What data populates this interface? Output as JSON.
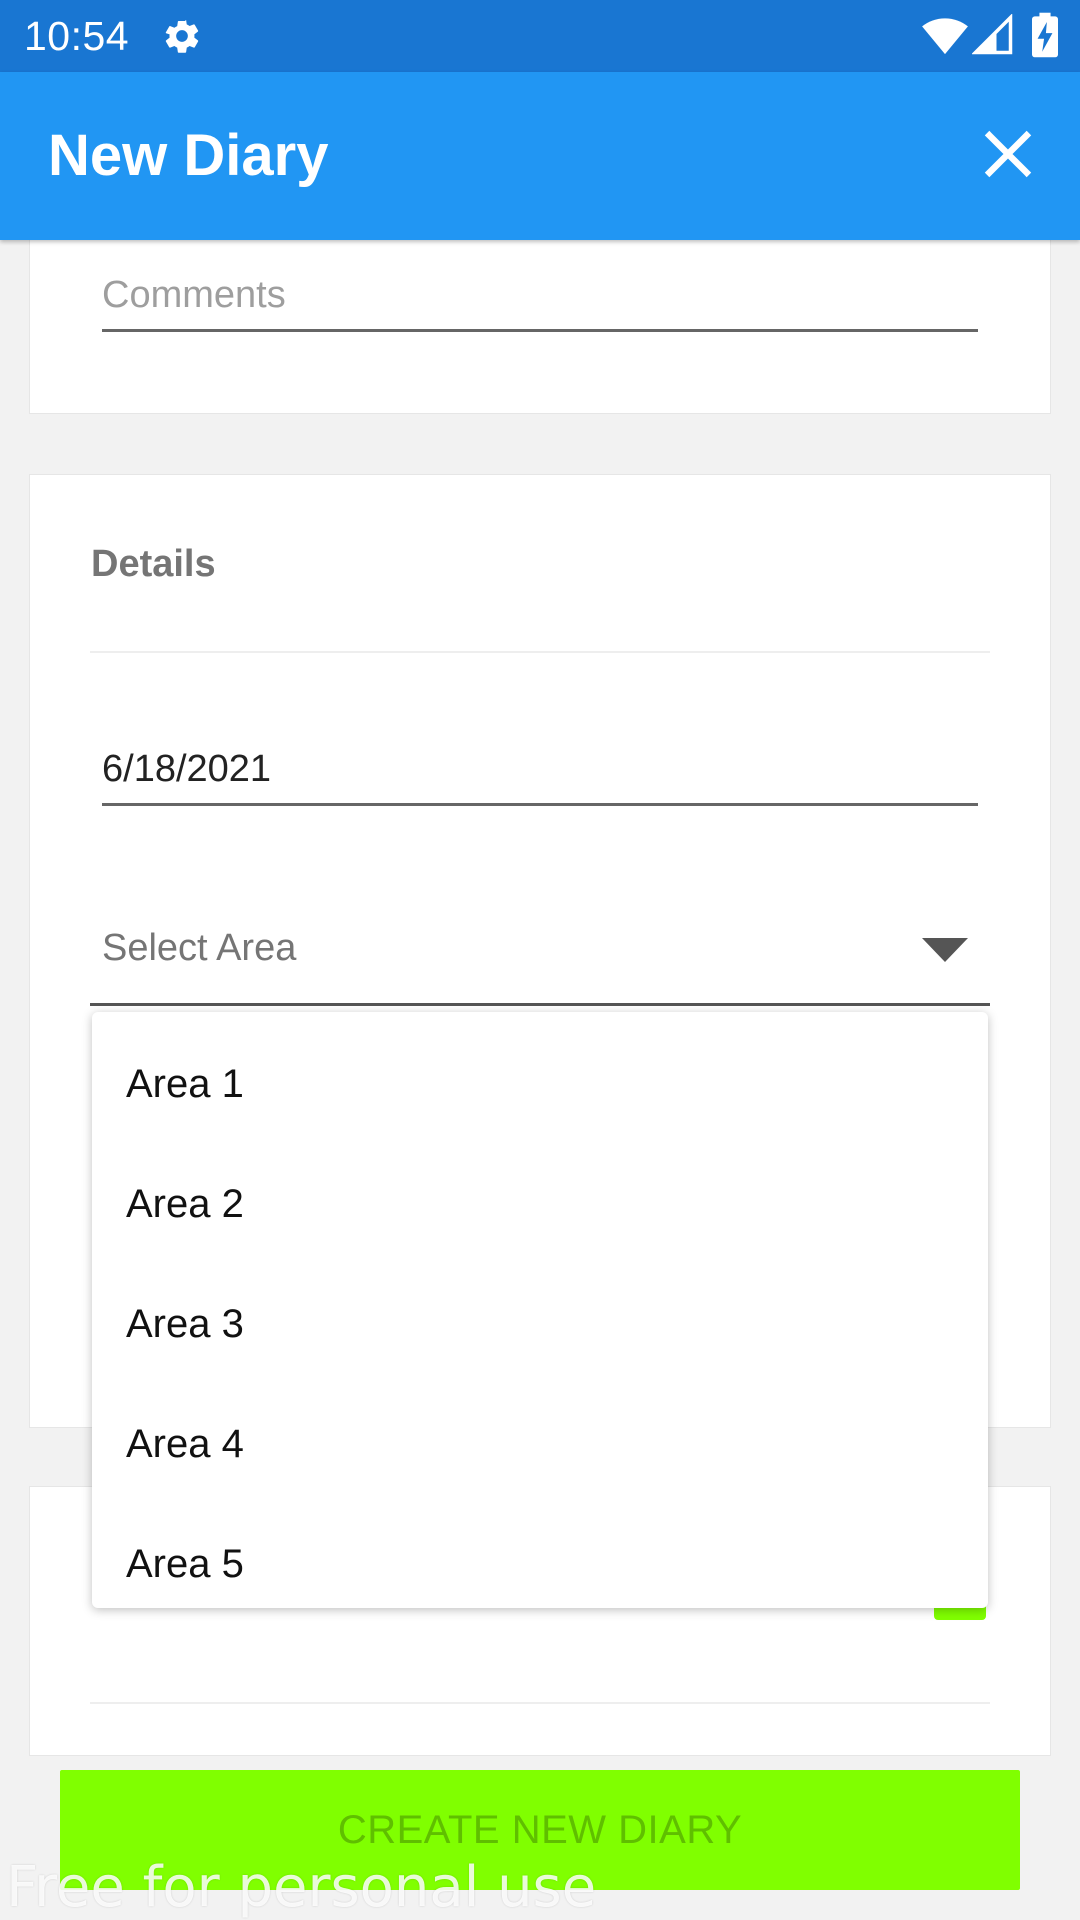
{
  "status_bar": {
    "time": "10:54",
    "icons": [
      "settings-gear-icon",
      "wifi-icon",
      "cell-signal-icon",
      "battery-charging-icon"
    ]
  },
  "app_bar": {
    "title": "New Diary",
    "close_icon": "close-icon",
    "background": "#2196f3"
  },
  "comments_field": {
    "placeholder": "Comments",
    "value": ""
  },
  "details": {
    "title": "Details",
    "date_value": "6/18/2021",
    "area_select": {
      "placeholder": "Select Area",
      "options": [
        "Area 1",
        "Area 2",
        "Area 3",
        "Area 4",
        "Area 5"
      ]
    }
  },
  "create_button": {
    "label": "CREATE NEW DIARY",
    "color": "#80ff00"
  },
  "watermark": "Free for personal use",
  "colors": {
    "status_bar": "#1976d2",
    "app_bar": "#2196f3",
    "accent_green": "#80ff00"
  }
}
